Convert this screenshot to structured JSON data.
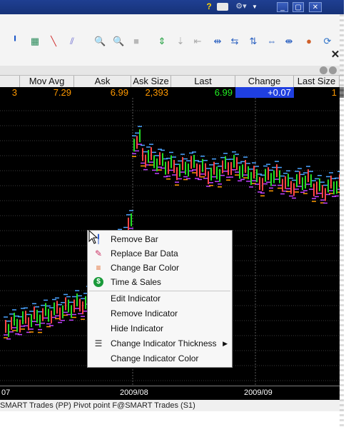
{
  "toolbar": {
    "icons": [
      "draw-line-icon",
      "chart-icon",
      "trendline-icon",
      "channel-icon",
      "zoom-in-icon",
      "zoom-out-icon",
      "blank-icon",
      "move-up-icon",
      "move-down-icon",
      "first-bar-icon",
      "prev-bar-icon",
      "next-bar-icon",
      "last-bar-icon",
      "expand-icon",
      "compress-icon",
      "palette-icon",
      "refresh-icon"
    ]
  },
  "quote": {
    "headers": [
      "Mov Avg",
      "Ask",
      "Ask Size",
      "Last",
      "Change",
      "Last Size"
    ],
    "values": {
      "partial": "3",
      "mov_avg": "7.29",
      "ask": "6.99",
      "ask_size": "2,393",
      "last": "6.99",
      "change": "+0.07",
      "last_size": "1"
    }
  },
  "chart_data": {
    "type": "bar",
    "x_ticks": [
      "07",
      "2009/08",
      "2009/09"
    ],
    "legend": "SMART Trades (PP)  Pivot point F@SMART Trades (S1)",
    "colors": {
      "up": "#22dd22",
      "down": "#ff4444",
      "pivot": "#4aa3ff",
      "s1": "#c040ff",
      "r1": "#ff9900"
    }
  },
  "context_menu": {
    "items": [
      {
        "label": "Remove Bar",
        "icon": "remove-bar-icon"
      },
      {
        "label": "Replace Bar Data",
        "icon": "replace-bar-icon"
      },
      {
        "label": "Change Bar Color",
        "icon": "bar-color-icon"
      },
      {
        "label": "Time & Sales",
        "icon": "time-sales-icon"
      },
      {
        "label": "Edit Indicator",
        "icon": ""
      },
      {
        "label": "Remove Indicator",
        "icon": ""
      },
      {
        "label": "Hide Indicator",
        "icon": ""
      },
      {
        "label": "Change Indicator Thickness",
        "icon": "thickness-icon"
      },
      {
        "label": "Change Indicator Color",
        "icon": ""
      }
    ]
  }
}
